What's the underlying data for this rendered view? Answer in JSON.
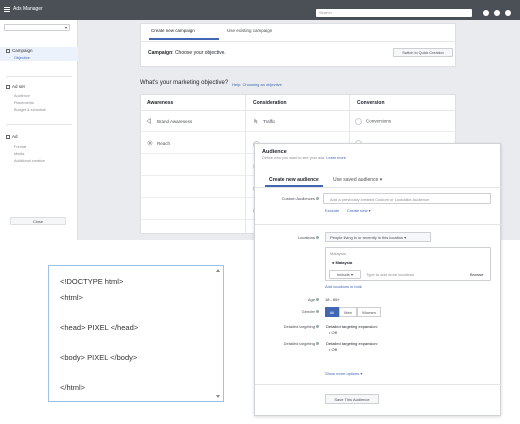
{
  "app": {
    "title": "Ads Manager",
    "search_placeholder": "Search"
  },
  "sidebar": {
    "sections": [
      {
        "title": "Campaign",
        "items": [
          "Objective"
        ]
      },
      {
        "title": "Ad set",
        "items": [
          "Audience",
          "Placements",
          "Budget & schedule"
        ]
      },
      {
        "title": "Ad",
        "items": [
          "Format",
          "Media",
          "Additional creative"
        ]
      }
    ],
    "close_label": "Close"
  },
  "campaign": {
    "tabs": [
      "Create new campaign",
      "Use existing campaign"
    ],
    "label_bold": "Campaign",
    "label_rest": ": Choose your objective.",
    "quick_button": "Switch to Quick Creation"
  },
  "objective": {
    "question": "What's your marketing objective?",
    "help_link": "Help: Choosing an objective",
    "columns": [
      "Awareness",
      "Consideration",
      "Conversion"
    ],
    "awareness": [
      "Brand Awareness",
      "Reach"
    ],
    "consideration": [
      "Traffic"
    ],
    "conversion": [
      "Conversions"
    ]
  },
  "code_panel": {
    "lines": [
      "<!DOCTYPE html>",
      "<html>",
      "<head> PIXEL </head>",
      "<body> PIXEL </body>",
      "</html>"
    ]
  },
  "audience": {
    "title": "Audience",
    "subtitle": "Define who you want to see your ads.",
    "learn_more": "Learn more",
    "tabs": [
      "Create new audience",
      "Use saved audience"
    ],
    "custom_label": "Custom Audiences",
    "custom_placeholder": "Add a previously created Custom or Lookalike Audience",
    "exclude": "Exclude",
    "create_new": "Create new",
    "locations_label": "Locations",
    "locations_dropdown": "People living in or recently in this location",
    "location_group": "Malaysia",
    "location_value": "Malaysia",
    "include": "Include",
    "location_placeholder": "Type to add more locations",
    "browse": "Browse",
    "add_bulk": "Add locations in bulk",
    "age_label": "Age",
    "age_value": "18 - 65+",
    "gender_label": "Gender",
    "genders": [
      "All",
      "Men",
      "Women"
    ],
    "detailed_label": "Detailed targeting",
    "detailed_expansion": "Detailed targeting expansion:",
    "off": "Off",
    "show_more": "Show more options",
    "save_button": "Save This Audience"
  }
}
